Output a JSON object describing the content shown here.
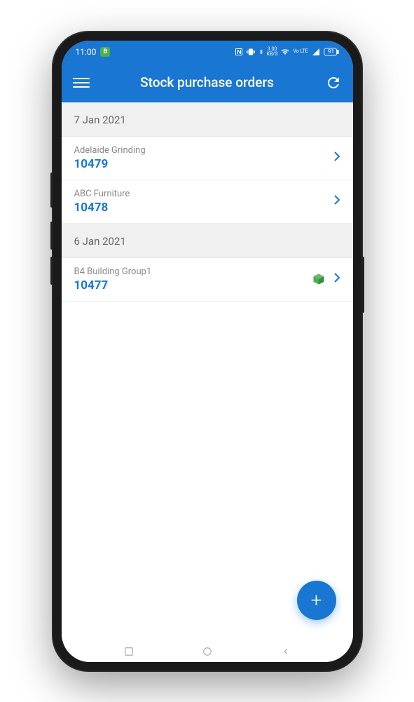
{
  "status_bar": {
    "time": "11:00",
    "network_speed": "3.00",
    "network_unit": "KB/S",
    "lte": "Vo LTE",
    "battery": "91"
  },
  "header": {
    "title": "Stock purchase orders"
  },
  "groups": [
    {
      "date": "7 Jan 2021",
      "orders": [
        {
          "customer": "Adelaide Grinding",
          "number": "10479",
          "has_box": false
        },
        {
          "customer": "ABC Furniture",
          "number": "10478",
          "has_box": false
        }
      ]
    },
    {
      "date": "6 Jan 2021",
      "orders": [
        {
          "customer": "B4 Building Group1",
          "number": "10477",
          "has_box": true
        }
      ]
    }
  ]
}
